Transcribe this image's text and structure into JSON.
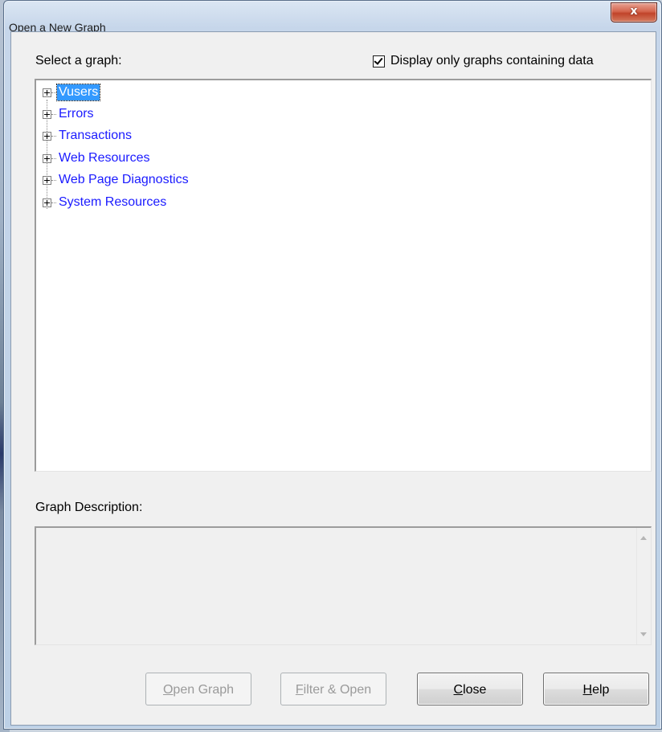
{
  "window": {
    "title": "Open a New Graph",
    "close_symbol": "x"
  },
  "select_label": "Select a graph:",
  "filter_checkbox": {
    "label": "Display only graphs containing data",
    "checked": true
  },
  "tree": {
    "items": [
      {
        "label": "Vusers",
        "selected": true
      },
      {
        "label": "Errors",
        "selected": false
      },
      {
        "label": "Transactions",
        "selected": false
      },
      {
        "label": "Web Resources",
        "selected": false
      },
      {
        "label": "Web Page Diagnostics",
        "selected": false
      },
      {
        "label": "System Resources",
        "selected": false
      }
    ]
  },
  "description": {
    "label": "Graph Description:",
    "text": ""
  },
  "buttons": {
    "open_graph": {
      "mnemonic": "O",
      "rest": "pen Graph",
      "enabled": false
    },
    "filter_open": {
      "mnemonic": "F",
      "rest": "ilter & Open",
      "enabled": false
    },
    "close": {
      "mnemonic": "C",
      "rest": "lose",
      "enabled": true
    },
    "help": {
      "mnemonic": "H",
      "rest": "elp",
      "enabled": true
    }
  },
  "colors": {
    "tree_link": "#1a1aff",
    "selection": "#3399ff"
  }
}
